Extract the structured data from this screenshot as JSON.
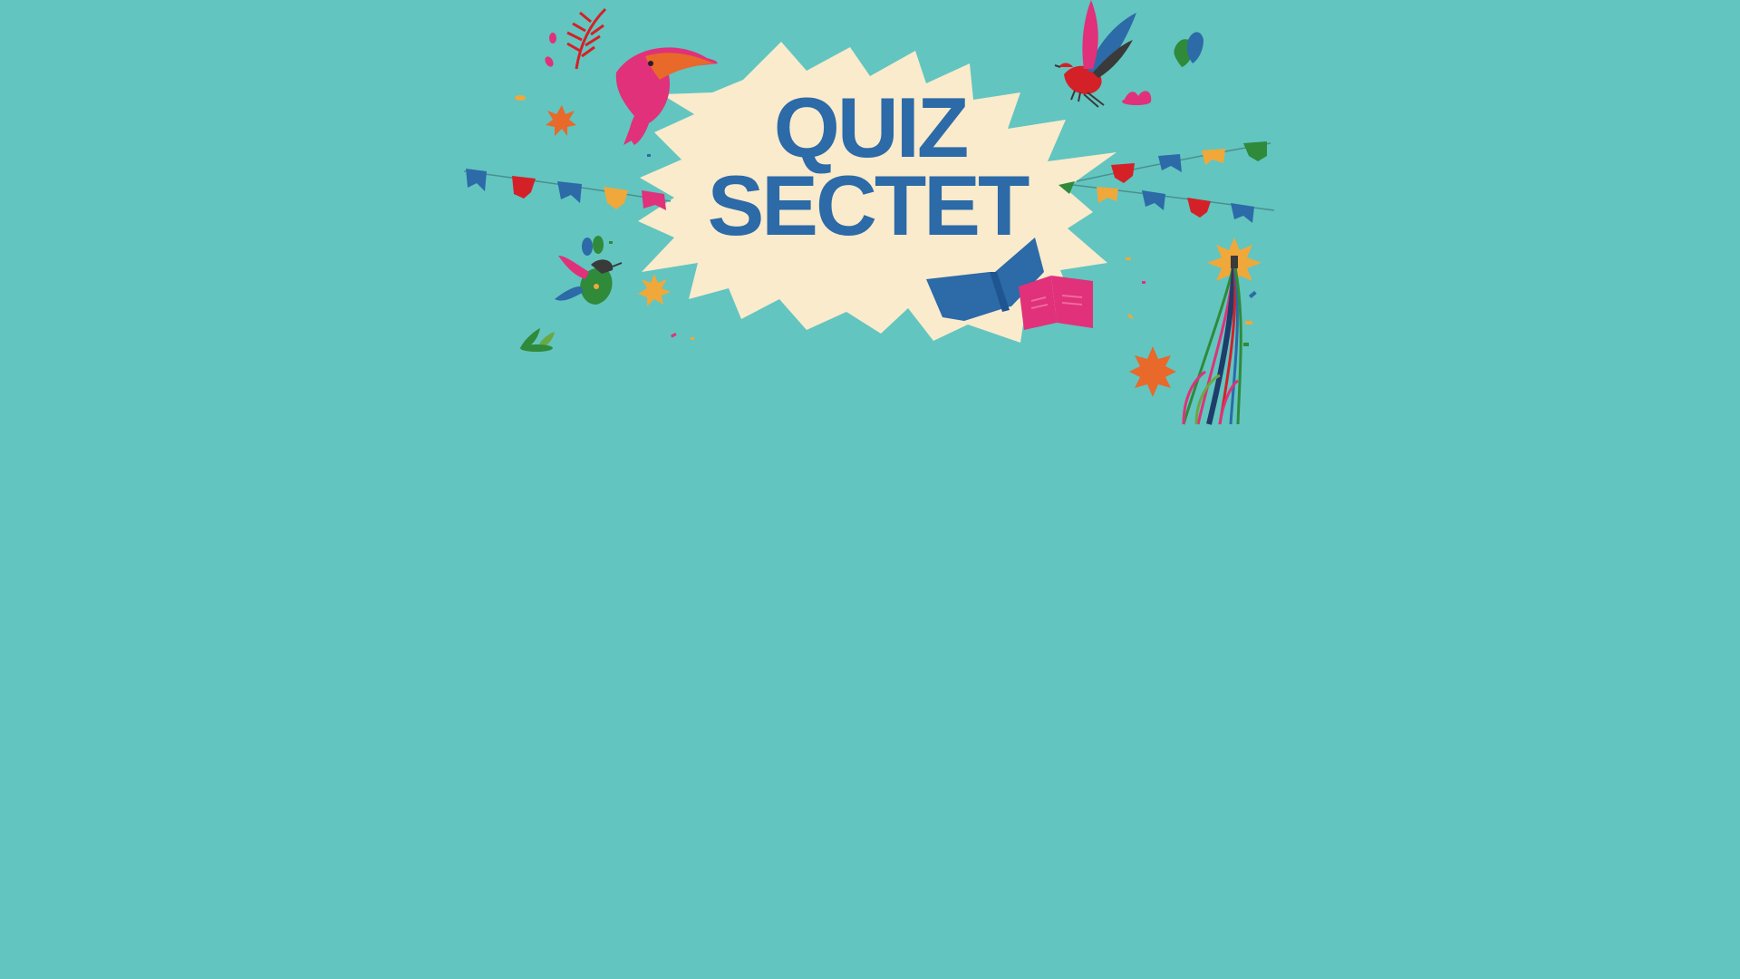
{
  "title": {
    "line1": "QUIZ",
    "line2": "SECTET"
  },
  "colors": {
    "background": "#62c5c0",
    "burst": "#faebcc",
    "title": "#2c6aa8",
    "pink": "#e0317a",
    "red": "#d42027",
    "orange": "#e8692a",
    "yellow": "#f0a83a",
    "green": "#2f8a3a",
    "blue": "#2c6aa8"
  },
  "decorations": [
    "dolphin-icon",
    "bird-icon",
    "hummingbird-icon",
    "book-icon",
    "bunting-flags",
    "maypole-ribbons",
    "star-icon",
    "leaf-icon"
  ]
}
